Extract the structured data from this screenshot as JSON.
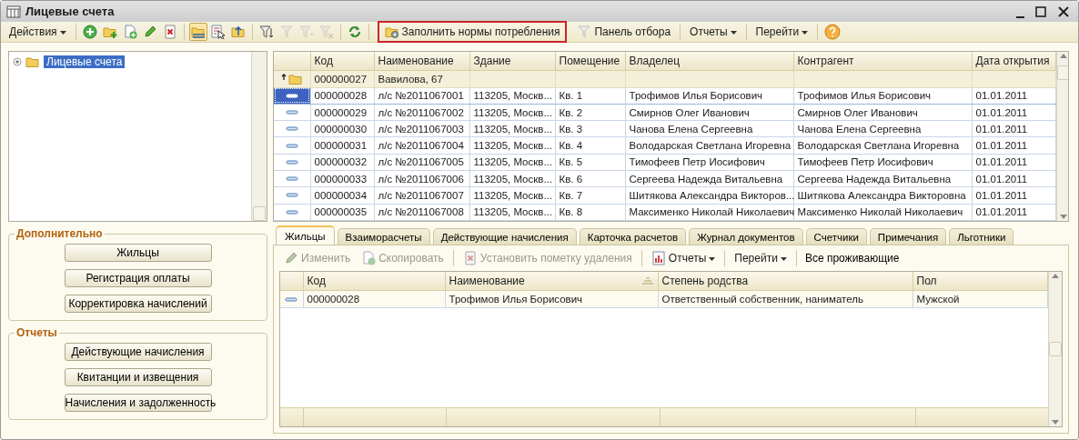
{
  "window": {
    "title": "Лицевые счета"
  },
  "toolbar": {
    "actions_menu": "Действия",
    "icon_buttons": [
      {
        "selected": false,
        "disabled": false
      },
      {
        "selected": false,
        "disabled": false
      },
      {
        "selected": false,
        "disabled": false
      },
      {
        "selected": false,
        "disabled": false
      },
      {
        "selected": false,
        "disabled": false
      },
      {
        "selected": true,
        "disabled": false
      },
      {
        "selected": false,
        "disabled": false
      },
      {
        "selected": false,
        "disabled": false
      },
      {
        "selected": false,
        "disabled": false
      },
      {
        "selected": false,
        "disabled": true
      },
      {
        "selected": false,
        "disabled": true
      },
      {
        "selected": false,
        "disabled": true
      },
      {
        "selected": false,
        "disabled": false
      }
    ],
    "fill_button": {
      "label": "Заполнить нормы потребления",
      "highlighted": true
    },
    "filter_panel_button": "Панель отбора",
    "menus": [
      "Отчеты",
      "Перейти"
    ]
  },
  "tree": {
    "items": [
      {
        "label": "Лицевые счета",
        "selected": true,
        "expanded": false
      }
    ]
  },
  "groups": [
    {
      "title": "Дополнительно",
      "buttons": [
        "Жильцы",
        "Регистрация оплаты",
        "Корректировка начислений"
      ]
    },
    {
      "title": "Отчеты",
      "buttons": [
        "Действующие начисления",
        "Квитанции и извещения",
        "Начисления и задолженность"
      ]
    }
  ],
  "table": {
    "columns": [
      "Код",
      "Наименование",
      "Здание",
      "Помещение",
      "Владелец",
      "Контрагент",
      "Дата открытия"
    ],
    "rows": [
      {
        "kind": "group",
        "selected": false,
        "cells": [
          "000000027",
          "Вавилова, 67",
          "",
          "",
          "",
          "",
          ""
        ]
      },
      {
        "kind": "item",
        "selected": true,
        "cells": [
          "000000028",
          "л/с №2011067001",
          "113205, Москв...",
          "Кв. 1",
          "Трофимов Илья Борисович",
          "Трофимов Илья Борисович",
          "01.01.2011"
        ]
      },
      {
        "kind": "item",
        "selected": false,
        "cells": [
          "000000029",
          "л/с №2011067002",
          "113205, Москв...",
          "Кв. 2",
          "Смирнов Олег Иванович",
          "Смирнов Олег Иванович",
          "01.01.2011"
        ]
      },
      {
        "kind": "item",
        "selected": false,
        "cells": [
          "000000030",
          "л/с №2011067003",
          "113205, Москв...",
          "Кв. 3",
          "Чанова Елена Сергеевна",
          "Чанова Елена Сергеевна",
          "01.01.2011"
        ]
      },
      {
        "kind": "item",
        "selected": false,
        "cells": [
          "000000031",
          "л/с №2011067004",
          "113205, Москв...",
          "Кв. 4",
          "Володарская Светлана Игоревна",
          "Володарская Светлана Игоревна",
          "01.01.2011"
        ]
      },
      {
        "kind": "item",
        "selected": false,
        "cells": [
          "000000032",
          "л/с №2011067005",
          "113205, Москв...",
          "Кв. 5",
          "Тимофеев Петр Иосифович",
          "Тимофеев Петр Иосифович",
          "01.01.2011"
        ]
      },
      {
        "kind": "item",
        "selected": false,
        "cells": [
          "000000033",
          "л/с №2011067006",
          "113205, Москв...",
          "Кв. 6",
          "Сергеева Надежда Витальевна",
          "Сергеева Надежда Витальевна",
          "01.01.2011"
        ]
      },
      {
        "kind": "item",
        "selected": false,
        "cells": [
          "000000034",
          "л/с №2011067007",
          "113205, Москв...",
          "Кв. 7",
          "Шитякова Александра Викторов...",
          "Шитякова Александра Викторовна",
          "01.01.2011"
        ]
      },
      {
        "kind": "item",
        "selected": false,
        "cells": [
          "000000035",
          "л/с №2011067008",
          "113205, Москв...",
          "Кв. 8",
          "Максименко Николай Николаевич",
          "Максименко Николай Николаевич",
          "01.01.2011"
        ]
      }
    ]
  },
  "tabs": [
    {
      "label": "Жильцы",
      "selected": true
    },
    {
      "label": "Взаиморасчеты",
      "selected": false
    },
    {
      "label": "Действующие начисления",
      "selected": false
    },
    {
      "label": "Карточка расчетов",
      "selected": false
    },
    {
      "label": "Журнал документов",
      "selected": false
    },
    {
      "label": "Счетчики",
      "selected": false
    },
    {
      "label": "Примечания",
      "selected": false
    },
    {
      "label": "Льготники",
      "selected": false
    }
  ],
  "sub_toolbar": {
    "buttons": [
      {
        "label": "Изменить",
        "disabled": true
      },
      {
        "label": "Скопировать",
        "disabled": true
      },
      {
        "label": "Установить пометку удаления",
        "disabled": true
      }
    ],
    "menus": [
      "Отчеты",
      "Перейти"
    ],
    "link": "Все проживающие"
  },
  "sub_table": {
    "columns": [
      "Код",
      "Наименование",
      "Степень родства",
      "Пол"
    ],
    "rows": [
      {
        "selected": false,
        "cells": [
          "000000028",
          "Трофимов Илья Борисович",
          "Ответственный собственник, наниматель",
          "Мужской"
        ]
      }
    ]
  }
}
